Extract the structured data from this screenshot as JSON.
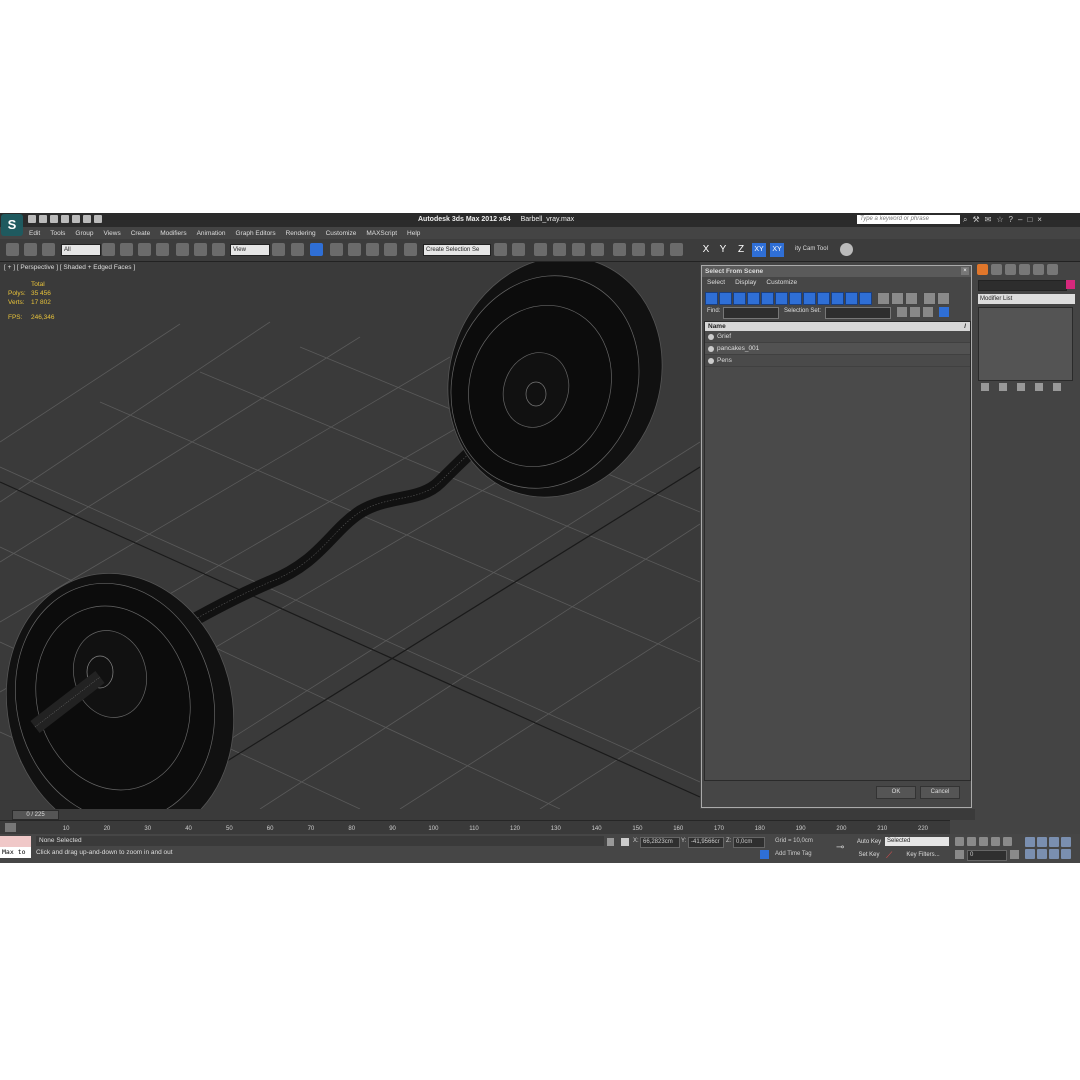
{
  "app": {
    "title": "Autodesk 3ds Max  2012 x64",
    "file": "Barbell_vray.max",
    "search_placeholder": "Type a keyword or phrase"
  },
  "menu": [
    "Edit",
    "Tools",
    "Group",
    "Views",
    "Create",
    "Modifiers",
    "Animation",
    "Graph Editors",
    "Rendering",
    "Customize",
    "MAXScript",
    "Help"
  ],
  "toolbar": {
    "filter": "All",
    "ref_coord": "View",
    "selection_set": "Create Selection Se",
    "axes": [
      "X",
      "Y",
      "Z",
      "XY",
      "XY"
    ],
    "extra_tool": "ity Cam Tool"
  },
  "viewport": {
    "label": "[ + ] [ Perspective ] [ Shaded + Edged Faces ]",
    "stats": {
      "header": "Total",
      "polys_label": "Polys:",
      "polys": "35 456",
      "verts_label": "Verts:",
      "verts": "17 802",
      "fps_label": "FPS:",
      "fps": "246,346"
    }
  },
  "select_dialog": {
    "title": "Select From Scene",
    "menu": [
      "Select",
      "Display",
      "Customize"
    ],
    "find_label": "Find:",
    "selection_set_label": "Selection Set:",
    "column": "Name",
    "items": [
      "Grief",
      "pancakes_001",
      "Pens"
    ],
    "ok": "OK",
    "cancel": "Cancel"
  },
  "command_panel": {
    "modifier_list": "Modifier List",
    "color": "#d6287c"
  },
  "timeline": {
    "frame": "0 / 225",
    "ticks": [
      "10",
      "20",
      "30",
      "40",
      "50",
      "60",
      "70",
      "80",
      "90",
      "100",
      "110",
      "120",
      "130",
      "140",
      "150",
      "160",
      "170",
      "180",
      "190",
      "200",
      "210",
      "220"
    ]
  },
  "status": {
    "maxscript": "Max to",
    "selection": "None Selected",
    "prompt": "Click and drag up-and-down to zoom in and out",
    "x_label": "X:",
    "x": "66,2823cm",
    "y_label": "Y:",
    "y": "-41,9566cr",
    "z_label": "Z:",
    "z": "0,0cm",
    "grid": "Grid = 10,0cm",
    "add_time_tag": "Add Time Tag",
    "auto_key": "Auto Key",
    "set_key": "Set Key",
    "key_mode": "Selected",
    "key_filters": "Key Filters...",
    "frame_field": "0"
  }
}
